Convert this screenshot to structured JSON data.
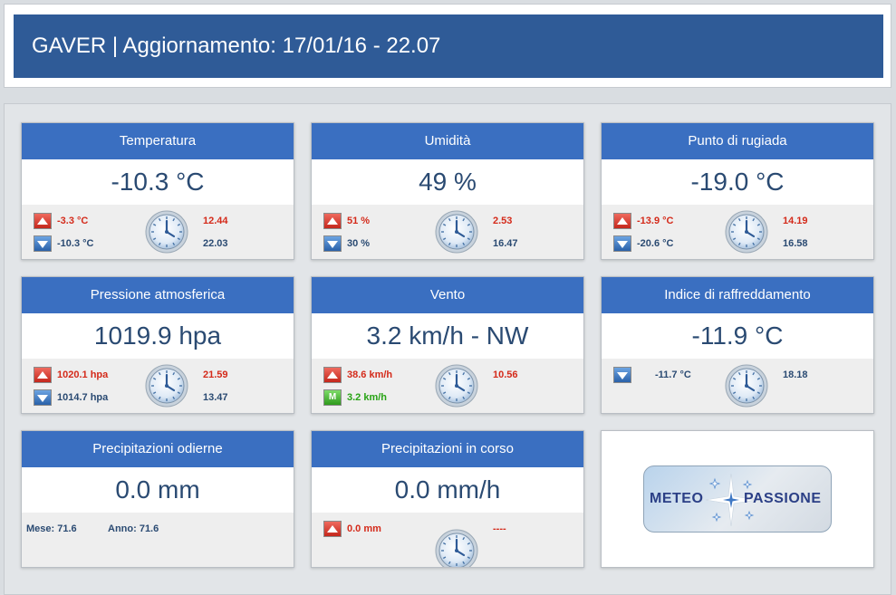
{
  "header": {
    "title": "GAVER | Aggiornamento: 17/01/16 - 22.07"
  },
  "cards": {
    "temperatura": {
      "title": "Temperatura",
      "value": "-10.3 °C",
      "max": "-3.3 °C",
      "max_time": "12.44",
      "min": "-10.3 °C",
      "min_time": "22.03"
    },
    "umidita": {
      "title": "Umidità",
      "value": "49 %",
      "max": "51 %",
      "max_time": "2.53",
      "min": "30 %",
      "min_time": "16.47"
    },
    "rugiada": {
      "title": "Punto di rugiada",
      "value": "-19.0 °C",
      "max": "-13.9 °C",
      "max_time": "14.19",
      "min": "-20.6 °C",
      "min_time": "16.58"
    },
    "pressione": {
      "title": "Pressione atmosferica",
      "value": "1019.9 hpa",
      "max": "1020.1 hpa",
      "max_time": "21.59",
      "min": "1014.7 hpa",
      "min_time": "13.47"
    },
    "vento": {
      "title": "Vento",
      "value": "3.2 km/h - NW",
      "max": "38.6 km/h",
      "max_time": "10.56",
      "gust": "3.2 km/h",
      "gust_icon_label": "M"
    },
    "raffreddamento": {
      "title": "Indice di raffreddamento",
      "value": "-11.9 °C",
      "min": "-11.7 °C",
      "min_time": "18.18"
    },
    "prec_odierne": {
      "title": "Precipitazioni odierne",
      "value": "0.0 mm",
      "mese": "Mese: 71.6",
      "anno": "Anno: 71.6"
    },
    "prec_corso": {
      "title": "Precipitazioni in corso",
      "value": "0.0 mm/h",
      "max": "0.0 mm",
      "max_time": "----"
    }
  },
  "logo": {
    "left_text": "METEO",
    "right_text": "PASSIONE"
  },
  "icons": {
    "arrow_up": "arrow-up-icon",
    "arrow_down": "arrow-down-icon",
    "clock": "clock-icon",
    "gust": "wind-gust-icon",
    "logo_star": "star-icon"
  },
  "colors": {
    "header_bar": "#2f5b97",
    "card_title": "#3a6fc1",
    "value_text": "#2a4a72",
    "max_red": "#d42a1a",
    "gust_green": "#27a314"
  }
}
